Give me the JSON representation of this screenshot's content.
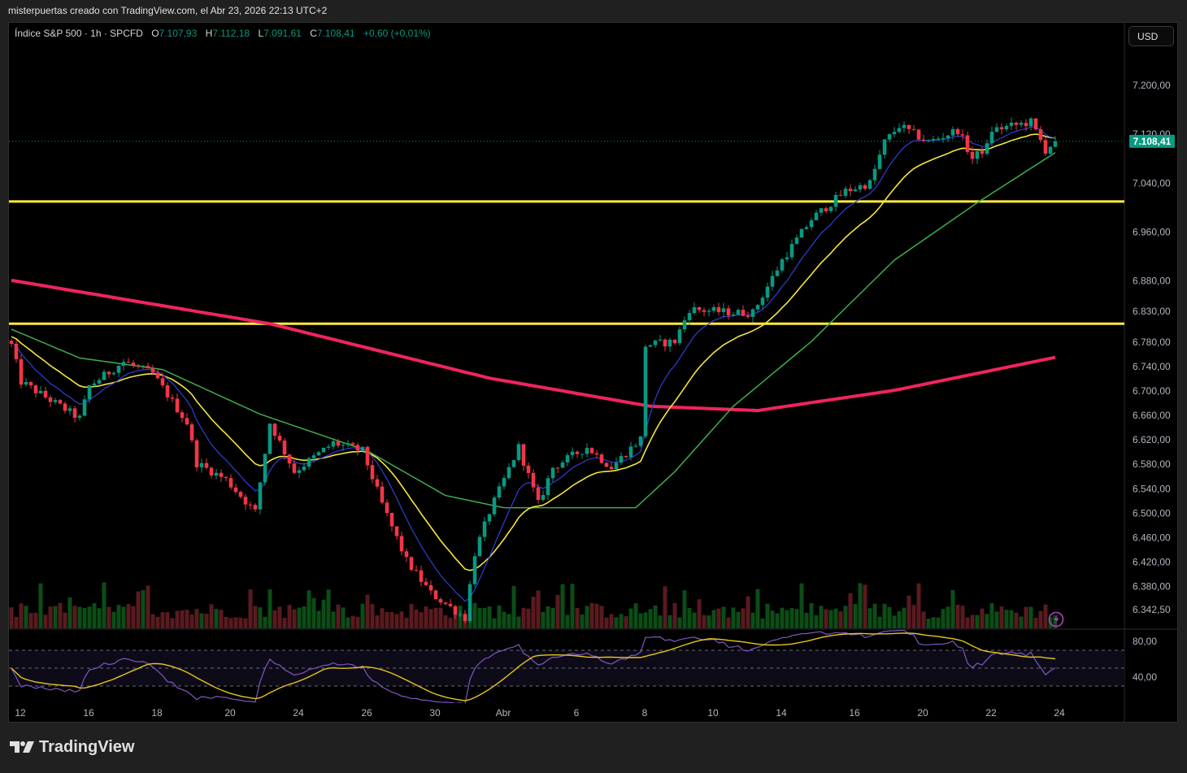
{
  "header": {
    "attribution": "misterpuertas creado con TradingView.com, el Abr 23, 2026 22:13 UTC+2"
  },
  "legend": {
    "symbol": "Índice S&P 500 · 1h · SPCFD",
    "open_label": "O",
    "open": "7.107,93",
    "high_label": "H",
    "high": "7.112,18",
    "low_label": "L",
    "low": "7.091,61",
    "close_label": "C",
    "close": "7.108,41",
    "change": "+0,60 (+0,01%)"
  },
  "currency_button": "USD",
  "current_price_label": "7.108,41",
  "logo_text": "TradingView",
  "colors": {
    "up": "#089981",
    "down": "#f23645",
    "ma_fast": "#2f3fd6",
    "ma_mid": "#f5e63a",
    "ma_slow": "#3fae4a",
    "ma_long": "#f0245f",
    "hline": "#ffeb3b",
    "rsi": "#7e57c2",
    "rsi_ma": "#e6c619",
    "vol_up": "#0c4d16",
    "vol_down": "#5a1a1f",
    "alert": "#b040c0"
  },
  "chart_data": {
    "type": "candlestick",
    "title": "Índice S&P 500 · 1h · SPCFD",
    "ylabel": "USD",
    "ylim": [
      6330,
      7230
    ],
    "price_ticks": [
      {
        "v": 7200,
        "t": "7.200,00"
      },
      {
        "v": 7120,
        "t": "7.120,00"
      },
      {
        "v": 7040,
        "t": "7.040,00"
      },
      {
        "v": 6960,
        "t": "6.960,00"
      },
      {
        "v": 6880,
        "t": "6.880,00"
      },
      {
        "v": 6830,
        "t": "6.830,00"
      },
      {
        "v": 6780,
        "t": "6.780,00"
      },
      {
        "v": 6740,
        "t": "6.740,00"
      },
      {
        "v": 6700,
        "t": "6.700,00"
      },
      {
        "v": 6660,
        "t": "6.660,00"
      },
      {
        "v": 6620,
        "t": "6.620,00"
      },
      {
        "v": 6580,
        "t": "6.580,00"
      },
      {
        "v": 6540,
        "t": "6.540,00"
      },
      {
        "v": 6500,
        "t": "6.500,00"
      },
      {
        "v": 6460,
        "t": "6.460,00"
      },
      {
        "v": 6420,
        "t": "6.420,00"
      },
      {
        "v": 6380,
        "t": "6.380,00"
      },
      {
        "v": 6342.5,
        "t": "6.342,50"
      }
    ],
    "time_ticks": [
      {
        "bar": 2,
        "t": "12"
      },
      {
        "bar": 16,
        "t": "16"
      },
      {
        "bar": 30,
        "t": "18"
      },
      {
        "bar": 45,
        "t": "20"
      },
      {
        "bar": 59,
        "t": "24"
      },
      {
        "bar": 73,
        "t": "26"
      },
      {
        "bar": 87,
        "t": "30"
      },
      {
        "bar": 101,
        "t": "Abr"
      },
      {
        "bar": 116,
        "t": "6"
      },
      {
        "bar": 130,
        "t": "8"
      },
      {
        "bar": 144,
        "t": "10"
      },
      {
        "bar": 158,
        "t": "14"
      },
      {
        "bar": 173,
        "t": "16"
      },
      {
        "bar": 187,
        "t": "20"
      },
      {
        "bar": 201,
        "t": "22"
      },
      {
        "bar": 215,
        "t": "24"
      }
    ],
    "bars": 215,
    "close_path": [
      [
        0,
        6775
      ],
      [
        2,
        6715
      ],
      [
        14,
        6655
      ],
      [
        16,
        6708
      ],
      [
        23,
        6748
      ],
      [
        29,
        6728
      ],
      [
        36,
        6648
      ],
      [
        38,
        6582
      ],
      [
        44,
        6555
      ],
      [
        50,
        6502
      ],
      [
        53,
        6648
      ],
      [
        58,
        6568
      ],
      [
        66,
        6615
      ],
      [
        72,
        6602
      ],
      [
        76,
        6515
      ],
      [
        81,
        6422
      ],
      [
        86,
        6369
      ],
      [
        93,
        6329
      ],
      [
        95,
        6435
      ],
      [
        98,
        6502
      ],
      [
        104,
        6608
      ],
      [
        108,
        6515
      ],
      [
        111,
        6575
      ],
      [
        118,
        6608
      ],
      [
        123,
        6575
      ],
      [
        129,
        6622
      ],
      [
        130,
        6775
      ],
      [
        136,
        6781
      ],
      [
        139,
        6834
      ],
      [
        148,
        6828
      ],
      [
        152,
        6828
      ],
      [
        158,
        6914
      ],
      [
        164,
        6981
      ],
      [
        171,
        7027
      ],
      [
        176,
        7040
      ],
      [
        179,
        7107
      ],
      [
        182,
        7134
      ],
      [
        188,
        7107
      ],
      [
        194,
        7127
      ],
      [
        197,
        7080
      ],
      [
        200,
        7100
      ],
      [
        201,
        7127
      ],
      [
        209,
        7140
      ],
      [
        212,
        7094
      ],
      [
        214,
        7108.41
      ]
    ],
    "ma_long_path": [
      [
        0,
        6881
      ],
      [
        53,
        6810
      ],
      [
        98,
        6721
      ],
      [
        131,
        6675
      ],
      [
        153,
        6668
      ],
      [
        181,
        6701
      ],
      [
        214,
        6755
      ]
    ],
    "ma_slow_path": [
      [
        0,
        6801
      ],
      [
        14,
        6754
      ],
      [
        31,
        6735
      ],
      [
        51,
        6662
      ],
      [
        73,
        6602
      ],
      [
        89,
        6529
      ],
      [
        101,
        6509
      ],
      [
        128,
        6509
      ],
      [
        136,
        6568
      ],
      [
        148,
        6675
      ],
      [
        164,
        6781
      ],
      [
        181,
        6914
      ],
      [
        198,
        7008
      ],
      [
        214,
        7090
      ]
    ],
    "horizontal_levels": [
      7010,
      6810
    ],
    "rsi": {
      "ticks": [
        {
          "v": 80,
          "t": "80,00"
        },
        {
          "v": 40,
          "t": "40,00"
        }
      ],
      "bands": [
        70,
        50,
        30
      ]
    }
  }
}
